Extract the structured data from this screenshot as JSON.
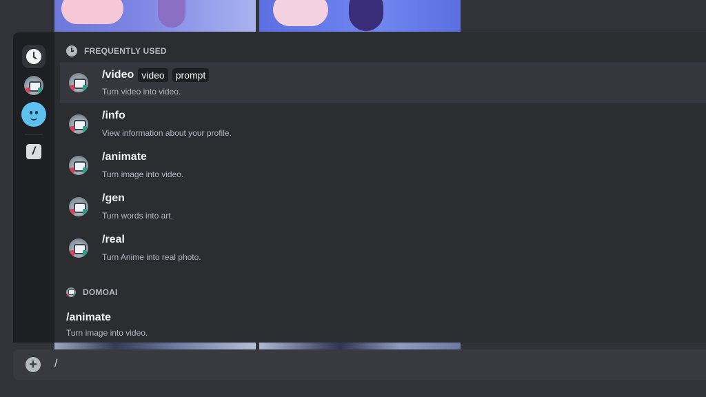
{
  "section_frequent": {
    "title": "FREQUENTLY USED"
  },
  "commands": [
    {
      "name": "/video",
      "options": [
        "video",
        "prompt"
      ],
      "description": "Turn video into video."
    },
    {
      "name": "/info",
      "options": [],
      "description": "View information about your profile."
    },
    {
      "name": "/animate",
      "options": [],
      "description": "Turn image into video."
    },
    {
      "name": "/gen",
      "options": [],
      "description": "Turn words into art."
    },
    {
      "name": "/real",
      "options": [],
      "description": "Turn Anime into real photo."
    }
  ],
  "section_bot": {
    "title": "DOMOAI",
    "command": {
      "name": "/animate",
      "description": "Turn image into video."
    }
  },
  "message_input": {
    "value": "/"
  },
  "icons": {
    "rail": [
      "clock-icon",
      "bot-avatar",
      "emoji-face-icon",
      "slash-command-icon"
    ],
    "input": "add-plus-icon"
  },
  "colors": {
    "background": "#313338",
    "popup": "#2b2d31",
    "rail": "#1e1f22",
    "active_row": "#35373c",
    "emoji_accent": "#5dc0ef"
  }
}
